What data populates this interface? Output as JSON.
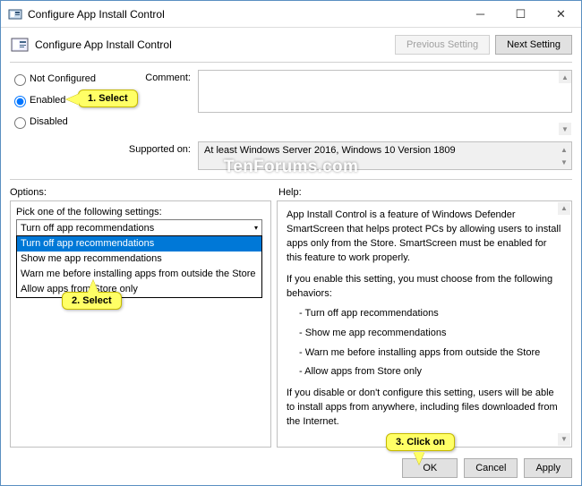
{
  "titlebar": {
    "title": "Configure App Install Control"
  },
  "header": {
    "title": "Configure App Install Control",
    "prev_btn": "Previous Setting",
    "next_btn": "Next Setting"
  },
  "radios": {
    "not_configured": "Not Configured",
    "enabled": "Enabled",
    "disabled": "Disabled"
  },
  "labels": {
    "comment": "Comment:",
    "supported": "Supported on:",
    "options": "Options:",
    "help": "Help:"
  },
  "supported_text": "At least Windows Server 2016, Windows 10 Version 1809",
  "options_panel": {
    "prompt": "Pick one of the following settings:",
    "selected": "Turn off app recommendations",
    "items": [
      "Turn off app recommendations",
      "Show me app recommendations",
      "Warn me before installing apps from outside the Store",
      "Allow apps from Store only"
    ]
  },
  "help_panel": {
    "p1": "App Install Control is a feature of Windows Defender SmartScreen that helps protect PCs by allowing users to install apps only from the Store. SmartScreen must be enabled for this feature to work properly.",
    "p2": "If you enable this setting, you must choose from the following behaviors:",
    "b1": "- Turn off app recommendations",
    "b2": "- Show me app recommendations",
    "b3": "- Warn me before installing apps from outside the Store",
    "b4": "- Allow apps from Store only",
    "p3": "If you disable or don't configure this setting, users will be able to install apps from anywhere, including files downloaded from the Internet."
  },
  "buttons": {
    "ok": "OK",
    "cancel": "Cancel",
    "apply": "Apply"
  },
  "callouts": {
    "c1": "1. Select",
    "c2": "2. Select",
    "c3": "3. Click on"
  },
  "watermark": "TenForums.com"
}
